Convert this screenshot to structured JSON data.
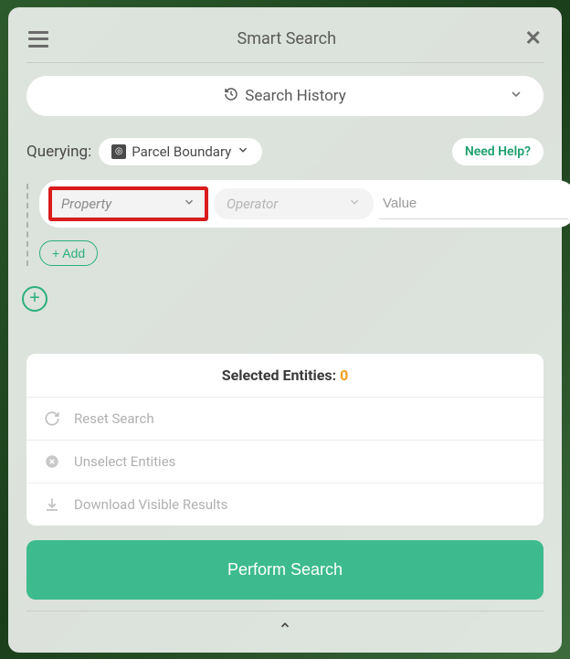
{
  "header": {
    "title": "Smart Search"
  },
  "search_history": {
    "label": "Search History"
  },
  "query": {
    "label": "Querying:",
    "layer": "Parcel Boundary",
    "help_label": "Need Help?"
  },
  "condition": {
    "property_placeholder": "Property",
    "operator_placeholder": "Operator",
    "value_placeholder": "Value"
  },
  "buttons": {
    "add": "+ Add",
    "perform": "Perform Search"
  },
  "entities": {
    "label": "Selected Entities: ",
    "count": "0"
  },
  "actions": {
    "reset": "Reset Search",
    "unselect": "Unselect Entities",
    "download": "Download Visible Results"
  }
}
